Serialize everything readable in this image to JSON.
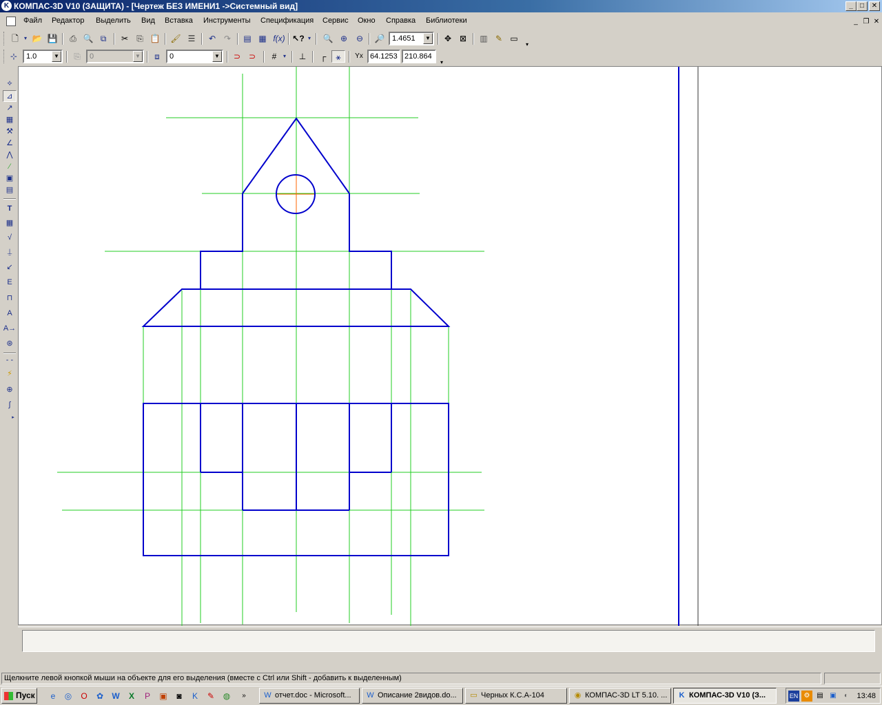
{
  "window": {
    "title": "КОМПАС-3D V10 (ЗАЩИТА) - [Чертеж БЕЗ ИМЕНИ1 ->Системный вид]",
    "minimize": "_",
    "maximize": "□",
    "close": "✕"
  },
  "menu": [
    "Файл",
    "Редактор",
    "Выделить",
    "Вид",
    "Вставка",
    "Инструменты",
    "Спецификация",
    "Сервис",
    "Окно",
    "Справка",
    "Библиотеки"
  ],
  "toolbar_standard": {
    "zoom_value": "1.4651"
  },
  "toolbar_current_state": {
    "step_value": "1.0",
    "layer_value": "0",
    "state_value": "0",
    "coord_x_label": "Y",
    "coord_x": "64.1253",
    "coord_y": "210.864"
  },
  "status": {
    "message": "Щелкните левой кнопкой мыши на объекте для его выделения (вместе с Ctrl или Shift - добавить к выделенным)"
  },
  "taskbar": {
    "start_label": "Пуск",
    "tasks": [
      {
        "label": "отчет.doc - Microsoft...",
        "icon": "word-icon",
        "active": false
      },
      {
        "label": "Описание 2видов.do...",
        "icon": "word-icon",
        "active": false
      },
      {
        "label": "Черных К.С.А-104",
        "icon": "folder-icon",
        "active": false
      },
      {
        "label": "КОМПАС-3D LT 5.10. ...",
        "icon": "kompas-lt-icon",
        "active": false
      },
      {
        "label": "КОМПАС-3D V10 (З...",
        "icon": "kompas-icon",
        "active": true
      }
    ],
    "lang": "EN",
    "clock": "13:48"
  },
  "colors": {
    "drawing_main": "#0000cc",
    "construction": "#22cc22",
    "centerline": "#ff6600"
  }
}
